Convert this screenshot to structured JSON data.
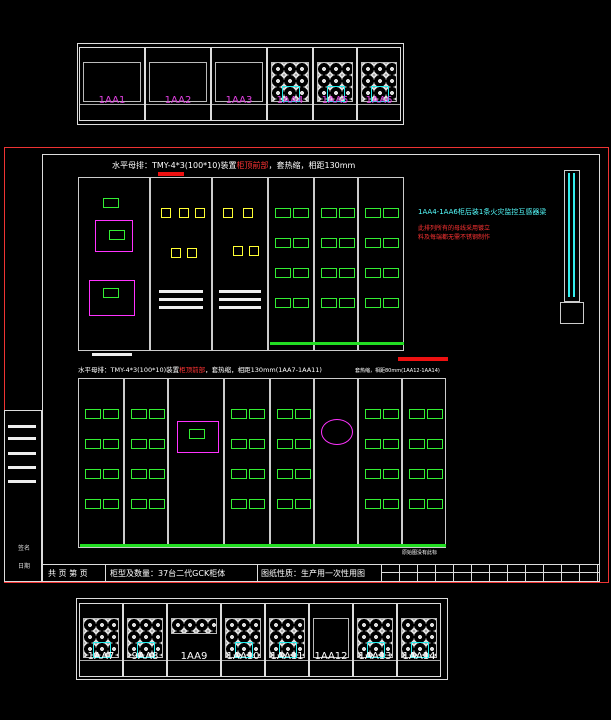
{
  "top_cabinets": [
    "1AA1",
    "1AA2",
    "1AA3",
    "1AA4",
    "1AA5",
    "1AA6"
  ],
  "bottom_cabinets": [
    "1AA7",
    "9AA8",
    "1AA9",
    "1AA10",
    "1AA11",
    "1AA12",
    "1AA13",
    "1AA14"
  ],
  "upper_busbar_title": {
    "prefix": "水平母排：TMY-4*3(100*10)装置",
    "highlight": "柜顶前部",
    "suffix": "，套热缩，相距130mm"
  },
  "lower_busbar_title": {
    "prefix": "水平母排：TMY-4*3(100*10)装置",
    "highlight": "柜顶前部",
    "suffix": "，套热缩，相距130mm(1AA7-1AA11)"
  },
  "lower_right_note": "套热缩，相距80mm(1AA12-1AA14)",
  "note_cyan": "1AA4-1AA6柜后装1条火灾监控互感器梁",
  "note_red_1": "此排列所有的母线采用镀立",
  "note_red_2": "料及每端都无需不锈钢制作",
  "bottom_small_note": "原始图没有此标",
  "side_labels": [
    "签名",
    "日期"
  ],
  "title_block": {
    "pages": "共 页 第 页",
    "cabinet_info": "柜型及数量：37台二代GCK柜体",
    "drawing_nature": "图纸性质：生产用一次性用图"
  }
}
